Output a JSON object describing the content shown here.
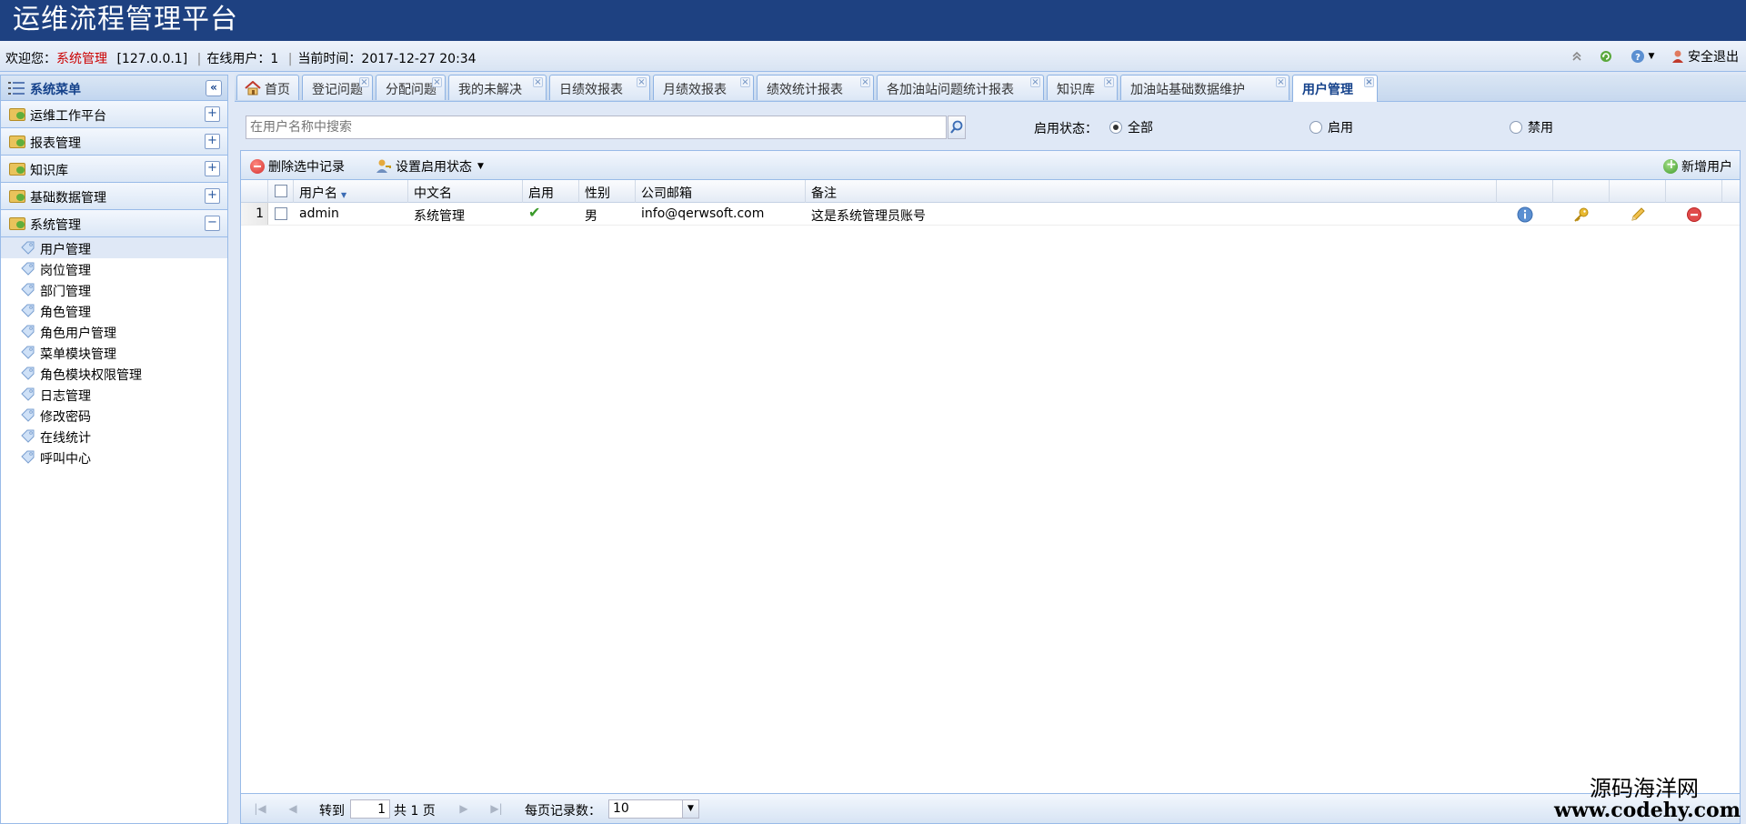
{
  "app": {
    "title": "运维流程管理平台"
  },
  "status": {
    "welcome_prefix": "欢迎您：",
    "user": "系统管理",
    "ip": "[127.0.0.1]",
    "online": "在线用户：1",
    "time": "当前时间：2017-12-27 20:34",
    "logout": "安全退出"
  },
  "sidebar": {
    "title": "系统菜单",
    "groups": [
      {
        "label": "运维工作平台",
        "toggle": "+"
      },
      {
        "label": "报表管理",
        "toggle": "+"
      },
      {
        "label": "知识库",
        "toggle": "+"
      },
      {
        "label": "基础数据管理",
        "toggle": "+"
      },
      {
        "label": "系统管理",
        "toggle": "−"
      }
    ],
    "items": [
      "用户管理",
      "岗位管理",
      "部门管理",
      "角色管理",
      "角色用户管理",
      "菜单模块管理",
      "角色模块权限管理",
      "日志管理",
      "修改密码",
      "在线统计",
      "呼叫中心"
    ]
  },
  "tabs": [
    "首页",
    "登记问题",
    "分配问题",
    "我的未解决",
    "日绩效报表",
    "月绩效报表",
    "绩效统计报表",
    "各加油站问题统计报表",
    "知识库",
    "加油站基础数据维护",
    "用户管理"
  ],
  "search": {
    "placeholder": "在用户名称中搜索",
    "status_label": "启用状态：",
    "options": [
      "全部",
      "启用",
      "禁用"
    ],
    "selected": "全部"
  },
  "toolbar": {
    "delete": "删除选中记录",
    "set_status": "设置启用状态",
    "add": "新增用户"
  },
  "table": {
    "columns": [
      "用户名",
      "中文名",
      "启用",
      "性别",
      "公司邮箱",
      "备注"
    ],
    "rows": [
      {
        "num": "1",
        "username": "admin",
        "cnname": "系统管理",
        "enabled": "✔",
        "gender": "男",
        "email": "info@qerwsoft.com",
        "note": "这是系统管理员账号"
      }
    ]
  },
  "pager": {
    "goto": "转到",
    "page": "1",
    "total": "共 1 页",
    "per_page_label": "每页记录数：",
    "per_page": "10"
  },
  "watermark": {
    "line1": "源码海洋网",
    "line2": "www.codehy.com"
  },
  "colors": {
    "header": "#1e4181",
    "accent": "#15428b",
    "border": "#99bbe8",
    "user": "#cc0000"
  }
}
